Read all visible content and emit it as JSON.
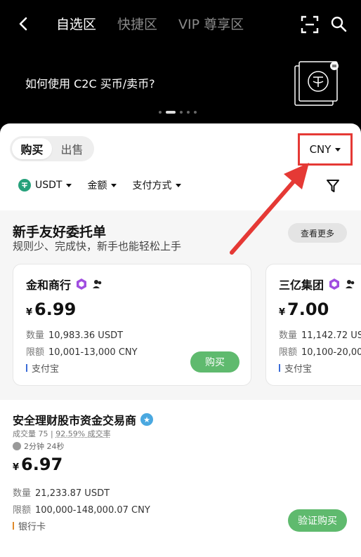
{
  "header": {
    "tabs": [
      {
        "label": "自选区",
        "active": true
      },
      {
        "label": "快捷区",
        "active": false
      },
      {
        "label": "VIP 尊享区",
        "active": false
      }
    ],
    "icons": {
      "back": "chevron-left-icon",
      "scan": "scan-icon",
      "search": "search-icon"
    }
  },
  "banner": {
    "text": "如何使用 C2C 买币/卖币?",
    "slide_count": 5,
    "active_slide": 2
  },
  "trade": {
    "segments": [
      {
        "label": "购买",
        "active": true
      },
      {
        "label": "出售",
        "active": false
      }
    ],
    "currency": "CNY",
    "highlight_color": "#e53935"
  },
  "filters": [
    {
      "label": "USDT",
      "icon": "usdt-icon"
    },
    {
      "label": "金额"
    },
    {
      "label": "支付方式"
    }
  ],
  "friendly": {
    "title": "新手友好委托单",
    "subtitle": "规则少、完成快，新手也能轻松上手",
    "more_label": "查看更多",
    "cards": [
      {
        "merchant": "金和商行",
        "yen": "¥",
        "price": "6.99",
        "qty_label": "数量",
        "qty": "10,983.36 USDT",
        "limit_label": "限额",
        "limit": "10,001-13,000 CNY",
        "payment": "支付宝",
        "payment_color": "#3b6cd8",
        "button": "购买"
      },
      {
        "merchant": "三亿集团",
        "yen": "¥",
        "price": "7.00",
        "qty_label": "数量",
        "qty": "11,142.72 US",
        "limit_label": "限额",
        "limit": "10,100-20,00",
        "payment": "支付宝",
        "payment_color": "#3b6cd8"
      }
    ]
  },
  "listing": {
    "merchant": "安全理财股市资金交易商",
    "volume": "成交量 75",
    "rate": "92.59% 成交率",
    "time": "2分钟 24秒",
    "yen": "¥",
    "price": "6.97",
    "qty_label": "数量",
    "qty": "21,233.87 USDT",
    "limit_label": "限额",
    "limit": "100,000-148,000.07 CNY",
    "payment": "银行卡",
    "payment_color": "#e08a2b",
    "button": "验证购买"
  },
  "colors": {
    "accent_green": "#5fba6e",
    "annotation_red": "#e53935"
  }
}
